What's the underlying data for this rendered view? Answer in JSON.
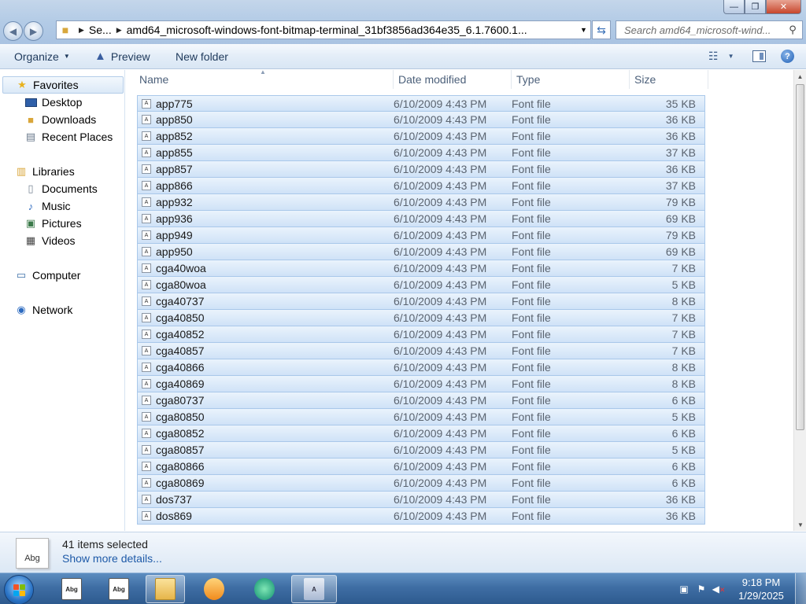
{
  "window": {
    "minimize_label": "—",
    "maximize_label": "❐",
    "close_label": "✕"
  },
  "address": {
    "crumb_root": "Se...",
    "crumb_current": "amd64_microsoft-windows-font-bitmap-terminal_31bf3856ad364e35_6.1.7600.1..."
  },
  "search": {
    "placeholder": "Search amd64_microsoft-wind..."
  },
  "toolbar": {
    "organize_label": "Organize",
    "preview_label": "Preview",
    "new_folder_label": "New folder"
  },
  "nav": {
    "favorites": "Favorites",
    "desktop": "Desktop",
    "downloads": "Downloads",
    "recent_places": "Recent Places",
    "libraries": "Libraries",
    "documents": "Documents",
    "music": "Music",
    "pictures": "Pictures",
    "videos": "Videos",
    "computer": "Computer",
    "network": "Network"
  },
  "columns": {
    "name": "Name",
    "date": "Date modified",
    "type": "Type",
    "size": "Size"
  },
  "files": [
    {
      "name": "app775",
      "date": "6/10/2009 4:43 PM",
      "type": "Font file",
      "size": "35 KB"
    },
    {
      "name": "app850",
      "date": "6/10/2009 4:43 PM",
      "type": "Font file",
      "size": "36 KB"
    },
    {
      "name": "app852",
      "date": "6/10/2009 4:43 PM",
      "type": "Font file",
      "size": "36 KB"
    },
    {
      "name": "app855",
      "date": "6/10/2009 4:43 PM",
      "type": "Font file",
      "size": "37 KB"
    },
    {
      "name": "app857",
      "date": "6/10/2009 4:43 PM",
      "type": "Font file",
      "size": "36 KB"
    },
    {
      "name": "app866",
      "date": "6/10/2009 4:43 PM",
      "type": "Font file",
      "size": "37 KB"
    },
    {
      "name": "app932",
      "date": "6/10/2009 4:43 PM",
      "type": "Font file",
      "size": "79 KB"
    },
    {
      "name": "app936",
      "date": "6/10/2009 4:43 PM",
      "type": "Font file",
      "size": "69 KB"
    },
    {
      "name": "app949",
      "date": "6/10/2009 4:43 PM",
      "type": "Font file",
      "size": "79 KB"
    },
    {
      "name": "app950",
      "date": "6/10/2009 4:43 PM",
      "type": "Font file",
      "size": "69 KB"
    },
    {
      "name": "cga40woa",
      "date": "6/10/2009 4:43 PM",
      "type": "Font file",
      "size": "7 KB"
    },
    {
      "name": "cga80woa",
      "date": "6/10/2009 4:43 PM",
      "type": "Font file",
      "size": "5 KB"
    },
    {
      "name": "cga40737",
      "date": "6/10/2009 4:43 PM",
      "type": "Font file",
      "size": "8 KB"
    },
    {
      "name": "cga40850",
      "date": "6/10/2009 4:43 PM",
      "type": "Font file",
      "size": "7 KB"
    },
    {
      "name": "cga40852",
      "date": "6/10/2009 4:43 PM",
      "type": "Font file",
      "size": "7 KB"
    },
    {
      "name": "cga40857",
      "date": "6/10/2009 4:43 PM",
      "type": "Font file",
      "size": "7 KB"
    },
    {
      "name": "cga40866",
      "date": "6/10/2009 4:43 PM",
      "type": "Font file",
      "size": "8 KB"
    },
    {
      "name": "cga40869",
      "date": "6/10/2009 4:43 PM",
      "type": "Font file",
      "size": "8 KB"
    },
    {
      "name": "cga80737",
      "date": "6/10/2009 4:43 PM",
      "type": "Font file",
      "size": "6 KB"
    },
    {
      "name": "cga80850",
      "date": "6/10/2009 4:43 PM",
      "type": "Font file",
      "size": "5 KB"
    },
    {
      "name": "cga80852",
      "date": "6/10/2009 4:43 PM",
      "type": "Font file",
      "size": "6 KB"
    },
    {
      "name": "cga80857",
      "date": "6/10/2009 4:43 PM",
      "type": "Font file",
      "size": "5 KB"
    },
    {
      "name": "cga80866",
      "date": "6/10/2009 4:43 PM",
      "type": "Font file",
      "size": "6 KB"
    },
    {
      "name": "cga80869",
      "date": "6/10/2009 4:43 PM",
      "type": "Font file",
      "size": "6 KB"
    },
    {
      "name": "dos737",
      "date": "6/10/2009 4:43 PM",
      "type": "Font file",
      "size": "36 KB"
    },
    {
      "name": "dos869",
      "date": "6/10/2009 4:43 PM",
      "type": "Font file",
      "size": "36 KB"
    }
  ],
  "details": {
    "thumb_text": "Abg",
    "count": "41 items selected",
    "more": "Show more details..."
  },
  "taskbar": {
    "time": "9:18 PM",
    "date": "1/29/2025"
  },
  "colors": {
    "selection_fill": "#cfe2f7",
    "selection_border": "#a9c8ea",
    "link": "#1e5aa8"
  }
}
